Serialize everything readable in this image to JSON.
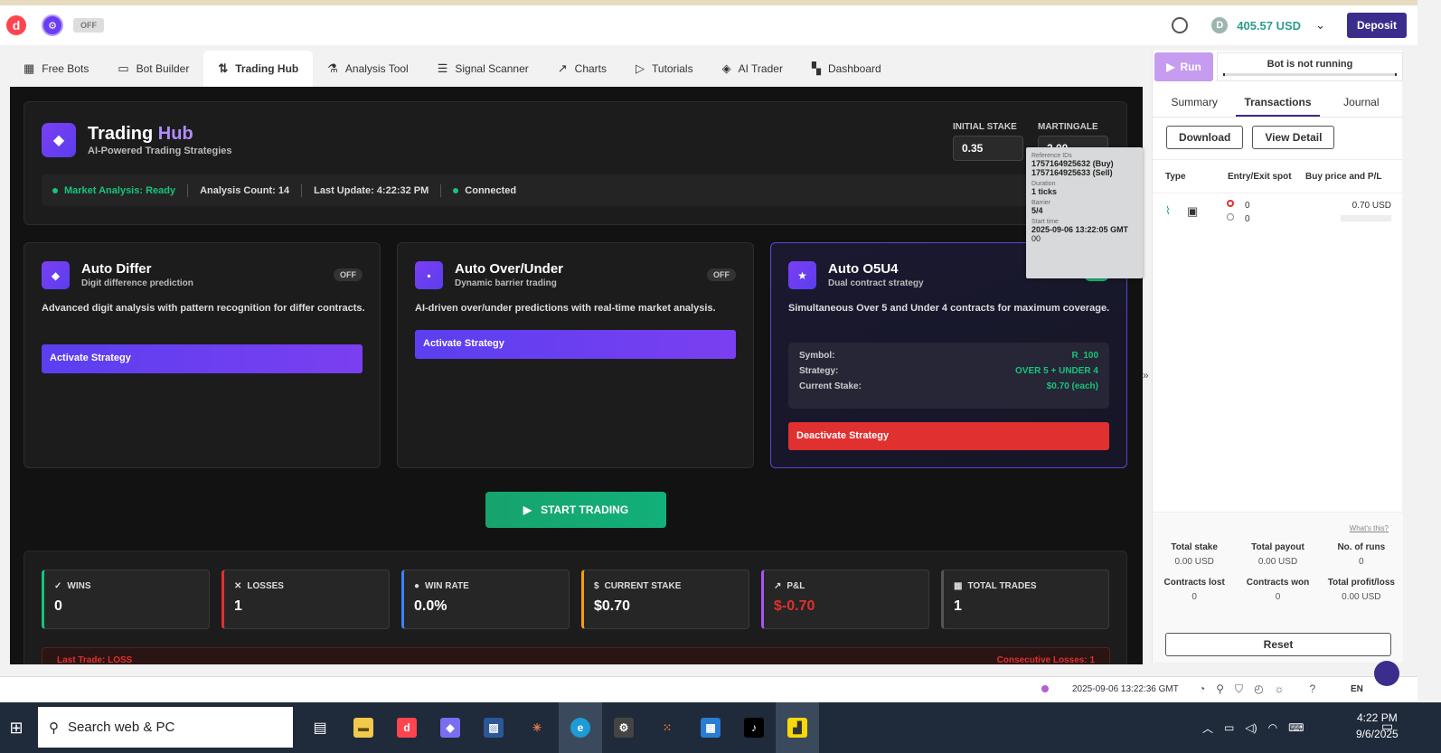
{
  "header": {
    "off_label": "OFF",
    "balance": "405.57 USD",
    "deposit_label": "Deposit"
  },
  "nav": {
    "tabs": [
      {
        "label": "Free Bots",
        "icon": "grid-icon"
      },
      {
        "label": "Bot Builder",
        "icon": "builder-icon"
      },
      {
        "label": "Trading Hub",
        "icon": "arrows-icon"
      },
      {
        "label": "Analysis Tool",
        "icon": "flask-icon"
      },
      {
        "label": "Signal Scanner",
        "icon": "list-icon"
      },
      {
        "label": "Charts",
        "icon": "chart-icon"
      },
      {
        "label": "Tutorials",
        "icon": "play-icon"
      },
      {
        "label": "AI Trader",
        "icon": "layers-icon"
      },
      {
        "label": "Dashboard",
        "icon": "dashboard-icon"
      }
    ]
  },
  "hub": {
    "title_main": "Trading",
    "title_accent": "Hub",
    "subtitle": "AI-Powered Trading Strategies",
    "initial_stake_label": "INITIAL STAKE",
    "initial_stake_value": "0.35",
    "martingale_label": "MARTINGALE",
    "martingale_value": "2.00",
    "status": {
      "market": "Market Analysis: Ready",
      "count": "Analysis Count: 14",
      "update": "Last Update: 4:22:32 PM",
      "connected": "Connected"
    }
  },
  "strategies": [
    {
      "title": "Auto Differ",
      "subtitle": "Digit difference prediction",
      "badge": "OFF",
      "desc": "Advanced digit analysis with pattern recognition for differ contracts.",
      "button": "Activate Strategy"
    },
    {
      "title": "Auto Over/Under",
      "subtitle": "Dynamic barrier trading",
      "badge": "OFF",
      "desc": "AI-driven over/under predictions with real-time market analysis.",
      "button": "Activate Strategy"
    },
    {
      "title": "Auto O5U4",
      "subtitle": "Dual contract strategy",
      "desc": "Simultaneous Over 5 and Under 4 contracts for maximum coverage.",
      "info": {
        "symbol_label": "Symbol:",
        "symbol_value": "R_100",
        "strategy_label": "Strategy:",
        "strategy_value": "OVER 5 + UNDER 4",
        "stake_label": "Current Stake:",
        "stake_value": "$0.70 (each)"
      },
      "button": "Deactivate Strategy"
    }
  ],
  "start_trading": "START TRADING",
  "stats": [
    {
      "label": "WINS",
      "value": "0",
      "color": "#17c37b",
      "icon": "check-icon",
      "glyph": "✓"
    },
    {
      "label": "LOSSES",
      "value": "1",
      "color": "#e0302f",
      "icon": "x-icon",
      "glyph": "✕"
    },
    {
      "label": "WIN RATE",
      "value": "0.0%",
      "color": "#3b82f6",
      "icon": "circle-icon",
      "glyph": "●"
    },
    {
      "label": "CURRENT STAKE",
      "value": "$0.70",
      "color": "#f59e0b",
      "icon": "dollar-icon",
      "glyph": "$"
    },
    {
      "label": "P&L",
      "value": "$-0.70",
      "color": "#a855f7",
      "icon": "trend-icon",
      "glyph": "↗"
    },
    {
      "label": "TOTAL TRADES",
      "value": "1",
      "color": "#555555",
      "icon": "calendar-icon",
      "glyph": "▦"
    }
  ],
  "last_trade": {
    "text": "Last Trade: LOSS",
    "right": "Consecutive Losses: 1"
  },
  "tooltip": {
    "ref_label": "Reference IDs",
    "ref_buy": "1757164925632 (Buy)",
    "ref_sell": "1757164925633 (Sell)",
    "duration_label": "Duration",
    "duration_value": "1 ticks",
    "barrier_label": "Barrier",
    "barrier_value": "5/4",
    "start_label": "Start time",
    "start_value": "2025-09-06 13:22:05 GMT",
    "start_value2": "00"
  },
  "panel": {
    "run_label": "Run",
    "bot_status": "Bot is not running",
    "tabs": [
      "Summary",
      "Transactions",
      "Journal"
    ],
    "download": "Download",
    "view_detail": "View Detail",
    "col_type": "Type",
    "col_entry": "Entry/Exit spot",
    "col_buy": "Buy price and P/L",
    "row_entry": "0",
    "row_exit": "0",
    "row_price": "0.70 USD",
    "whats_this": "What's this?",
    "summary": [
      {
        "label": "Total stake",
        "value": "0.00 USD"
      },
      {
        "label": "Total payout",
        "value": "0.00 USD"
      },
      {
        "label": "No. of runs",
        "value": "0"
      },
      {
        "label": "Contracts lost",
        "value": "0"
      },
      {
        "label": "Contracts won",
        "value": "0"
      },
      {
        "label": "Total profit/loss",
        "value": "0.00 USD"
      }
    ],
    "reset": "Reset"
  },
  "footer": {
    "timestamp": "2025-09-06 13:22:36 GMT",
    "lang": "EN"
  },
  "taskbar": {
    "search_placeholder": "Search web & PC",
    "time": "4:22 PM",
    "date": "9/6/2025"
  }
}
